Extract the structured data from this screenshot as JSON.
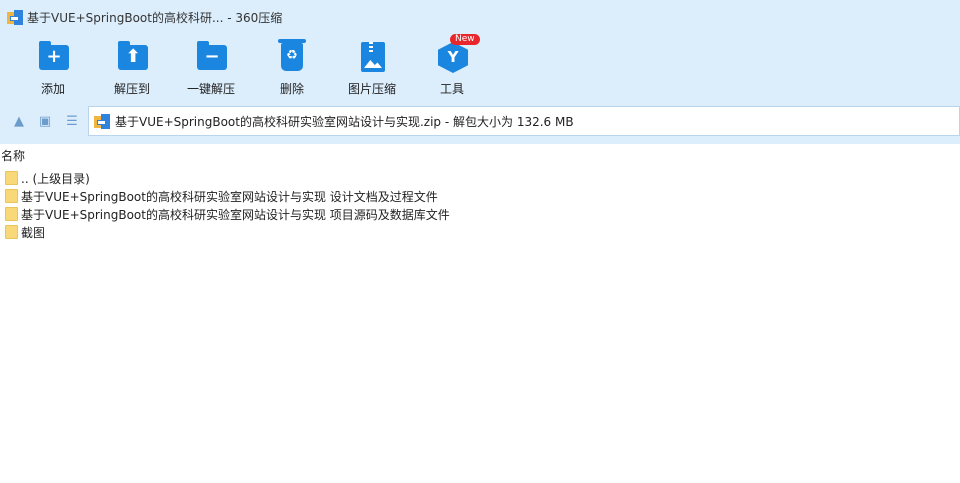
{
  "window": {
    "title": "基于VUE+SpringBoot的高校科研... - 360压缩"
  },
  "toolbar": {
    "items": [
      {
        "label": "添加",
        "icon": "add-folder-icon"
      },
      {
        "label": "解压到",
        "icon": "extract-to-icon"
      },
      {
        "label": "一键解压",
        "icon": "one-click-extract-icon"
      },
      {
        "label": "删除",
        "icon": "trash-icon"
      },
      {
        "label": "图片压缩",
        "icon": "image-compress-icon"
      },
      {
        "label": "工具",
        "icon": "tools-icon",
        "badge": "New"
      }
    ]
  },
  "nav": {
    "up_icon": "arrow-up-icon",
    "view_icon": "view-icon",
    "list_icon": "list-view-icon",
    "address": "基于VUE+SpringBoot的高校科研实验室网站设计与实现.zip - 解包大小为 132.6 MB"
  },
  "list": {
    "header": "名称",
    "rows": [
      {
        "name": ".. (上级目录)"
      },
      {
        "name": "基于VUE+SpringBoot的高校科研实验室网站设计与实现 设计文档及过程文件"
      },
      {
        "name": "基于VUE+SpringBoot的高校科研实验室网站设计与实现 项目源码及数据库文件"
      },
      {
        "name": "截图"
      }
    ]
  },
  "colors": {
    "chrome": "#dceefc",
    "accent": "#1a86e0",
    "folder": "#f8d879",
    "badge": "#e8262c"
  }
}
